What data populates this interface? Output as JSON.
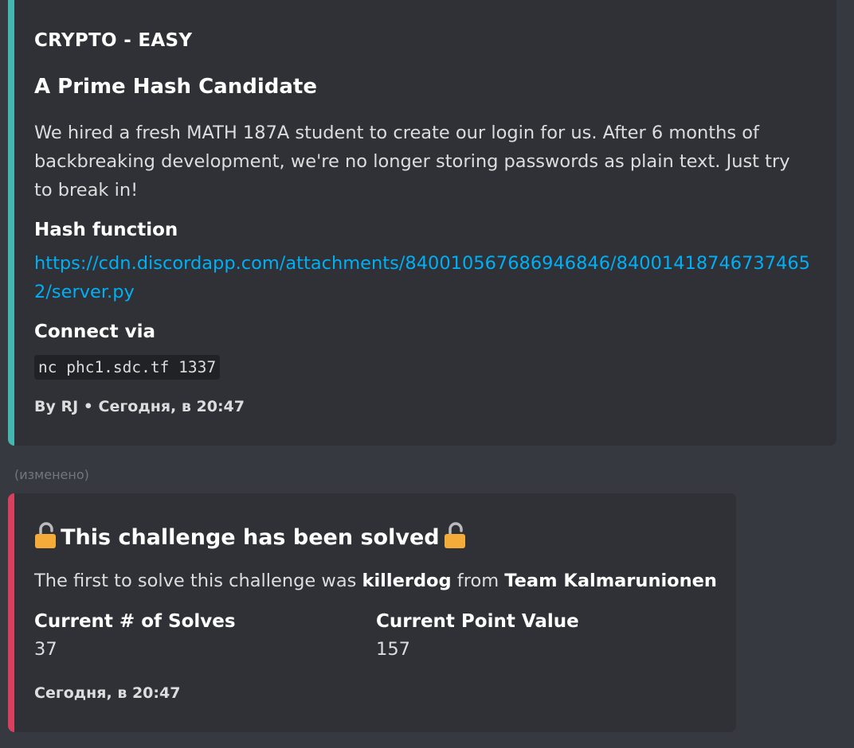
{
  "colors": {
    "embed1_bar": "#45b7b0",
    "embed2_bar": "#d8405f",
    "link": "#00aff4"
  },
  "embed1": {
    "author": "CRYPTO - EASY",
    "title": "A Prime Hash Candidate",
    "description": "We hired a fresh MATH 187A student to create our login for us. After 6 months of backbreaking development, we're no longer storing passwords as plain text. Just try to break in!",
    "fields": [
      {
        "name": "Hash function",
        "value": "https://cdn.discordapp.com/attachments/840010567686946846/840014187467374652/server.py"
      },
      {
        "name": "Connect via",
        "value": "nc phc1.sdc.tf 1337"
      }
    ],
    "footer": "By RJ • Сегодня, в 20:47"
  },
  "edited_label": "(изменено)",
  "embed2": {
    "title": "This challenge has been solved",
    "title_icon_left": "open-lock-icon",
    "title_icon_right": "open-lock-icon",
    "desc_prefix": "The first to solve this challenge was ",
    "solver": "killerdog",
    "desc_middle": " from ",
    "team": "Team Kalmarunionen",
    "fields": [
      {
        "name": "Current # of Solves",
        "value": "37"
      },
      {
        "name": "Current Point Value",
        "value": "157"
      }
    ],
    "footer": "Сегодня, в 20:47"
  }
}
